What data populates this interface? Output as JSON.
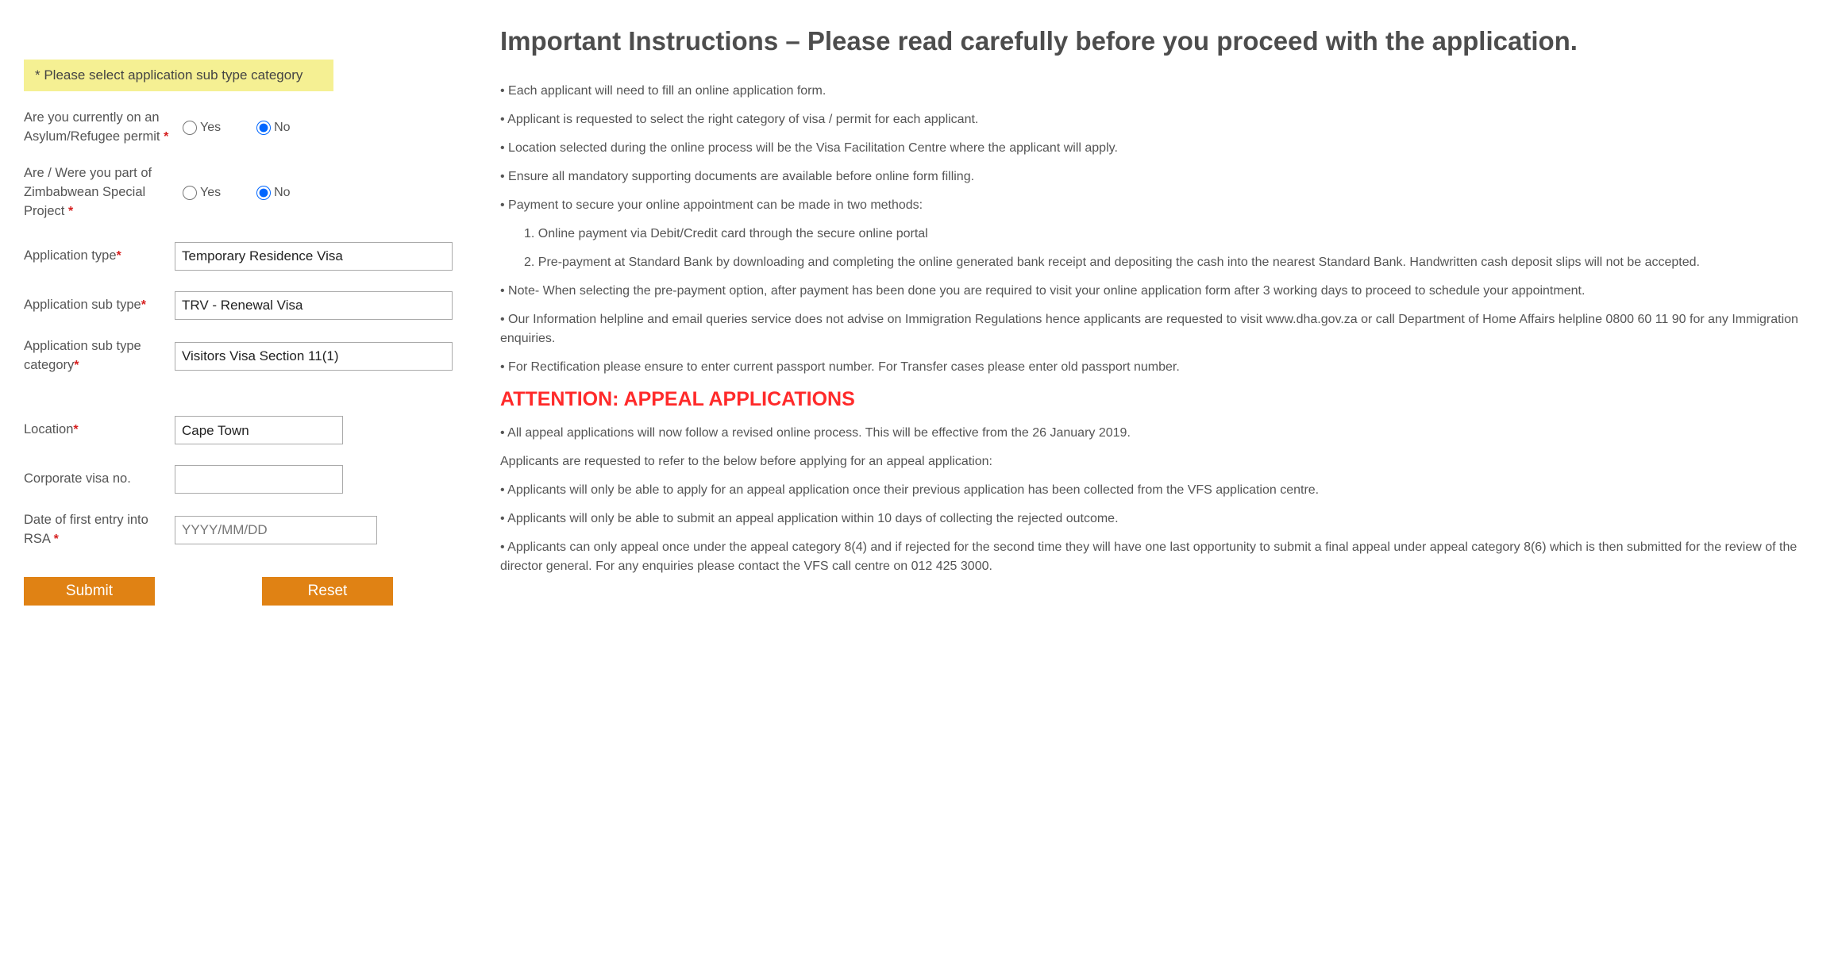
{
  "form": {
    "banner": "* Please select application sub type category",
    "labels": {
      "asylum": "Are you currently on an Asylum/Refugee permit",
      "zimbabwe": "Are / Were you part of Zimbabwean Special Project",
      "appType": "Application type",
      "appSubType": "Application sub type",
      "appSubTypeCategory": "Application sub type category",
      "location": "Location",
      "corporateVisa": "Corporate visa no.",
      "firstEntry": "Date of first entry into RSA"
    },
    "radio": {
      "yes": "Yes",
      "no": "No"
    },
    "values": {
      "appType": "Temporary Residence Visa",
      "appSubType": "TRV - Renewal Visa",
      "appSubTypeCategory": "Visitors Visa Section 11(1)",
      "location": "Cape Town",
      "corporateVisa": "",
      "firstEntryPlaceholder": "YYYY/MM/DD"
    },
    "buttons": {
      "submit": "Submit",
      "reset": "Reset"
    }
  },
  "instructions": {
    "title": "Important Instructions – Please read carefully before you proceed with the application.",
    "b1": "• Each applicant will need to fill an online application form.",
    "b2": "• Applicant is requested to select the right category of visa / permit for each applicant.",
    "b3": "• Location selected during the online process will be the Visa Facilitation Centre where the applicant will apply.",
    "b4": "• Ensure all mandatory supporting documents are available before online form filling.",
    "b5": "• Payment to secure your online appointment can be made in two methods:",
    "b5a": "1. Online payment via Debit/Credit card through the secure online portal",
    "b5b": "2. Pre-payment at Standard Bank by downloading and completing the online generated bank receipt and depositing the cash into the nearest Standard Bank. Handwritten cash deposit slips will not be accepted.",
    "b6": "• Note- When selecting the pre-payment option, after payment has been done you are required to visit your online application form after 3 working days to proceed to schedule your appointment.",
    "b7": "• Our Information helpline and email queries service does not advise on Immigration Regulations hence applicants are requested to visit www.dha.gov.za or call Department of Home Affairs helpline 0800 60 11 90 for any Immigration enquiries.",
    "b8": "• For Rectification please ensure to enter current passport number. For Transfer cases please enter old passport number.",
    "attention": "ATTENTION: APPEAL APPLICATIONS",
    "a1": "• All appeal applications will now follow a revised online process. This will be effective from the 26 January 2019.",
    "a2": "Applicants are requested to refer to the below before applying for an appeal application:",
    "a3": "• Applicants will only be able to apply for an appeal application once their previous application has been collected from the VFS application centre.",
    "a4": "• Applicants will only be able to submit an appeal application within 10 days of collecting the rejected outcome.",
    "a5": "• Applicants can only appeal once under the appeal category 8(4) and if rejected for the second time they will have one last opportunity to submit a final appeal under appeal category 8(6) which is then submitted for the review of the director general. For any enquiries please contact the VFS call centre on 012 425 3000."
  }
}
